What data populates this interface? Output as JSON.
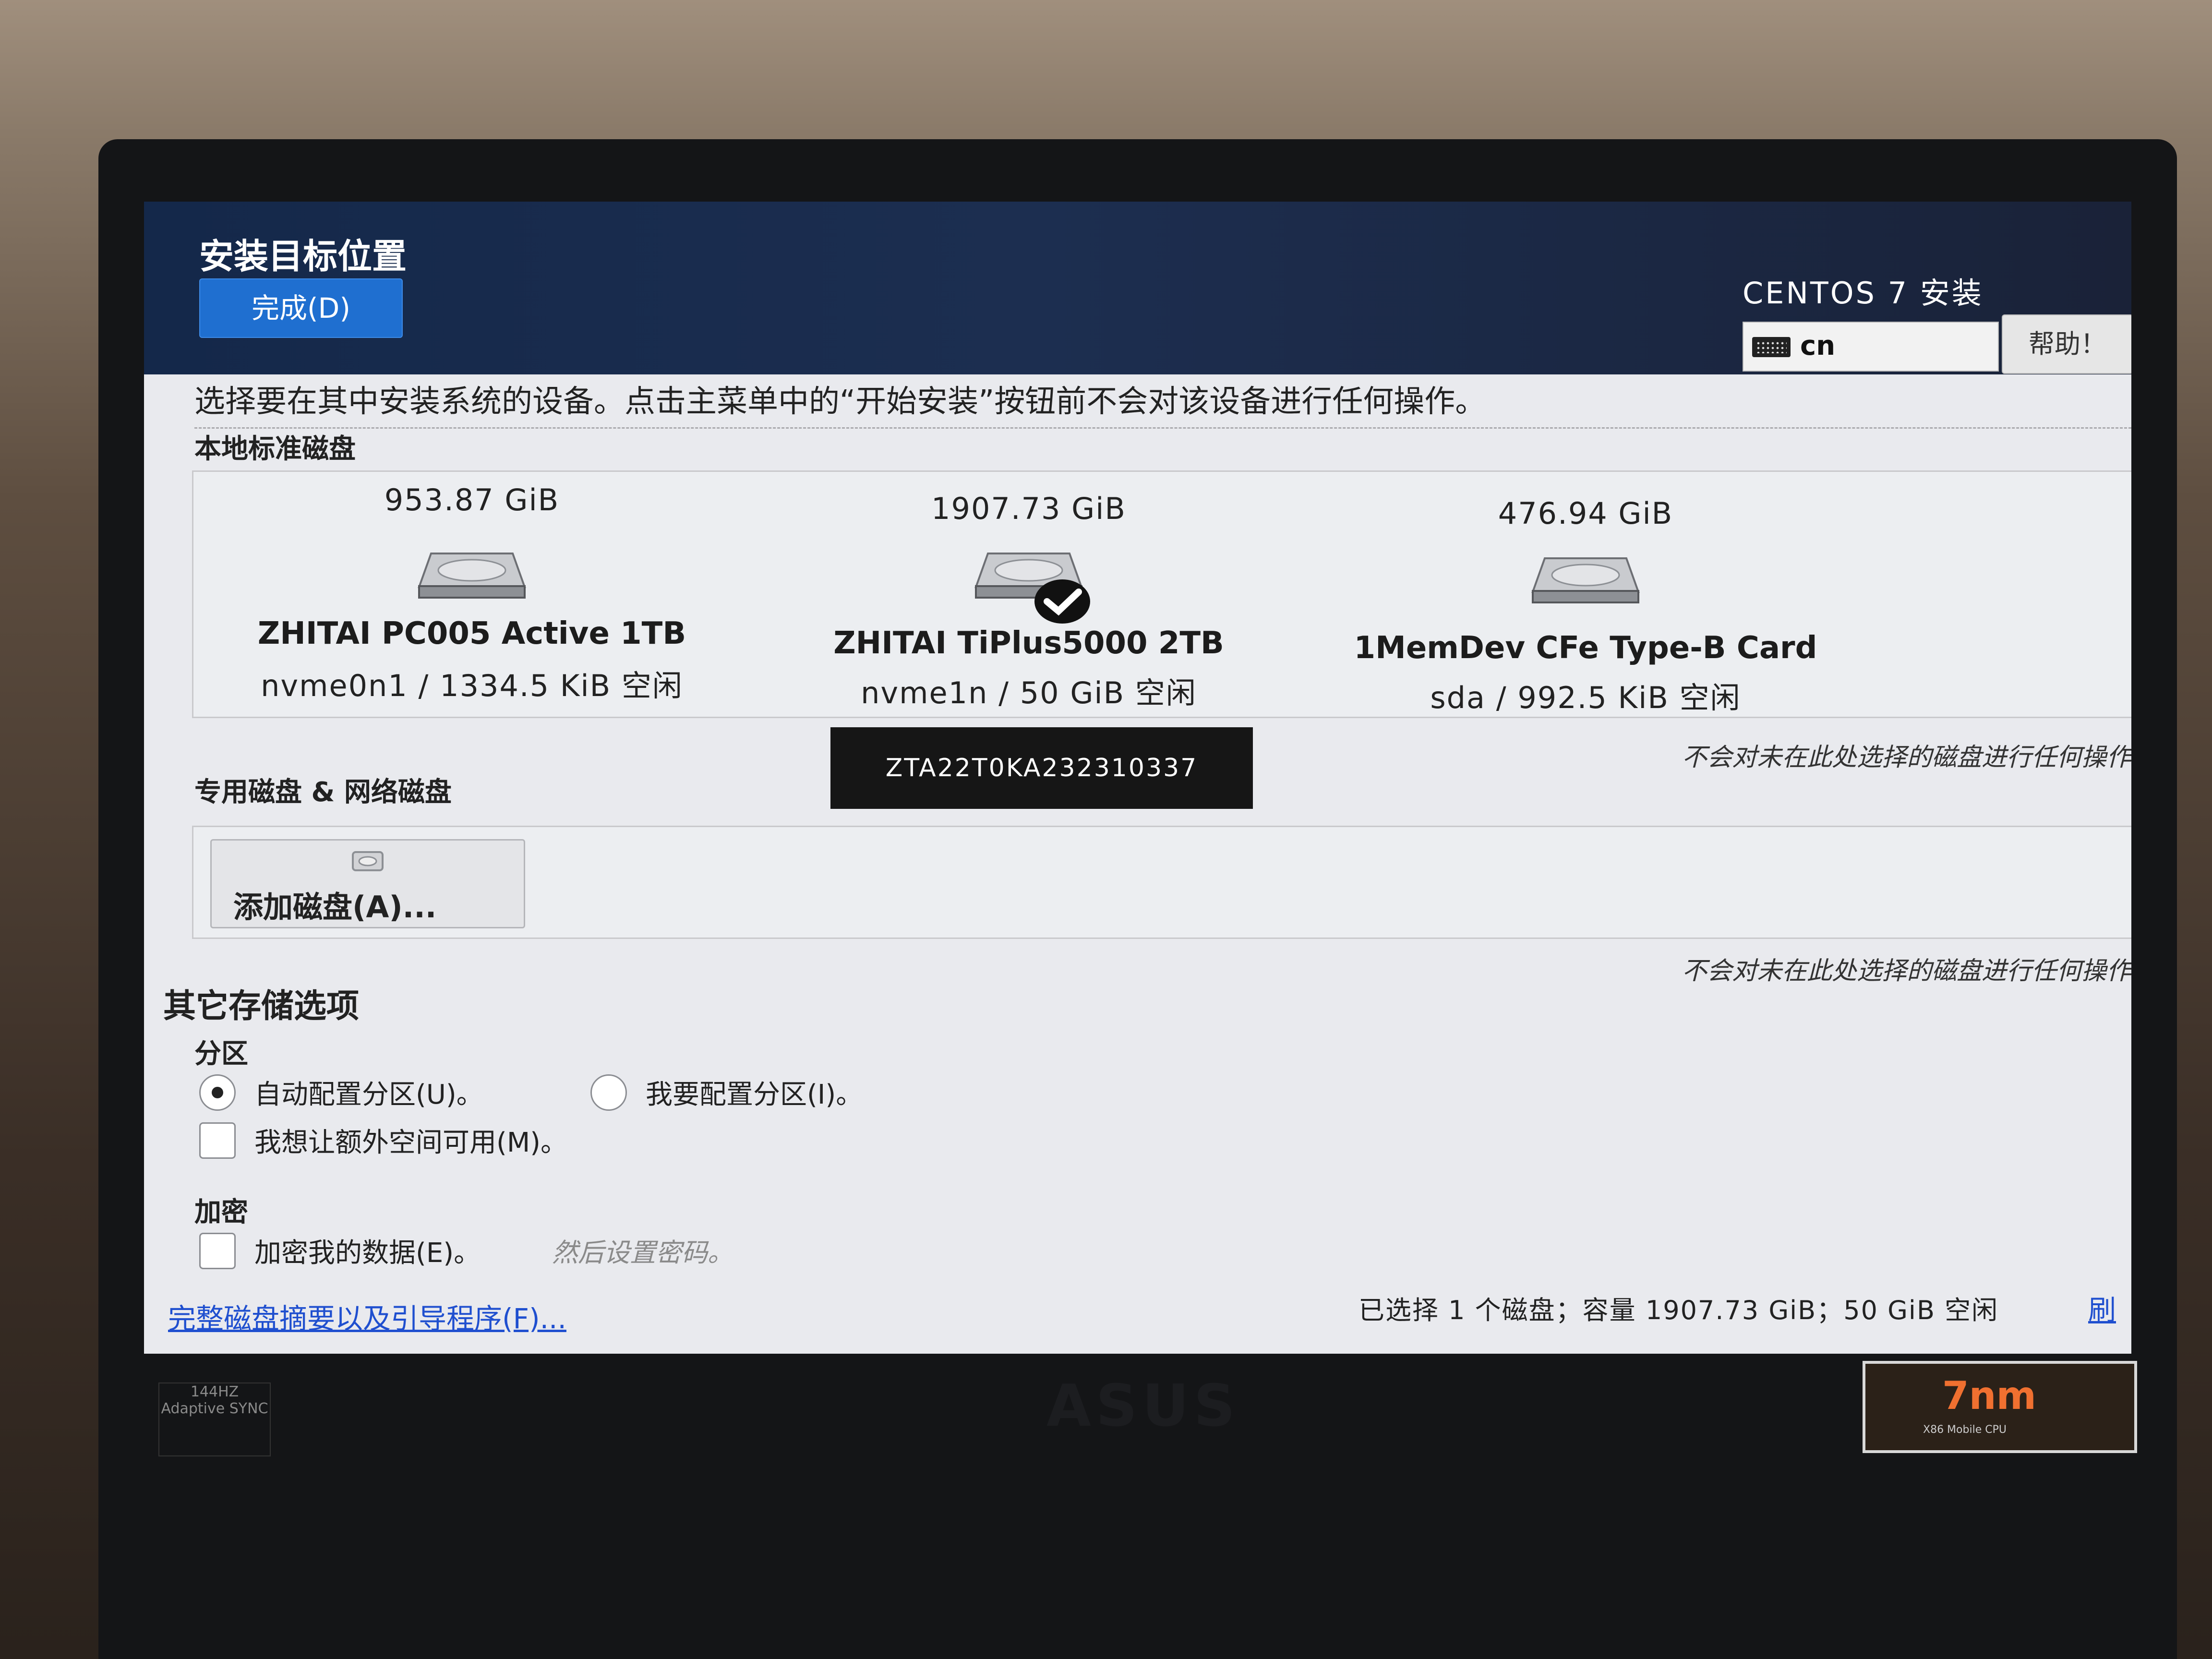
{
  "header": {
    "page_title": "安装目标位置",
    "done_label": "完成(D)",
    "product_title": "CENTOS 7 安装",
    "keyboard_layout": "cn",
    "help_label": "帮助！"
  },
  "intro_text": "选择要在其中安装系统的设备。点击主菜单中的“开始安装”按钮前不会对该设备进行任何操作。",
  "local_disks": {
    "label": "本地标准磁盘",
    "disks": [
      {
        "size": "953.87 GiB",
        "name": "ZHITAI PC005 Active 1TB",
        "device": "nvme0n1",
        "sep": "/",
        "free": "1334.5 KiB 空闲",
        "selected": false
      },
      {
        "size": "1907.73 GiB",
        "name": "ZHITAI TiPlus5000 2TB",
        "device": "nvme1n",
        "sep": "/",
        "free": "50 GiB 空闲",
        "selected": true
      },
      {
        "size": "476.94 GiB",
        "name": "1MemDev CFe Type-B Card",
        "device": "sda",
        "sep": "/",
        "free": "992.5 KiB 空闲",
        "selected": false
      }
    ],
    "note": "不会对未在此处选择的磁盘进行任何操作"
  },
  "tooltip_serial": "ZTA22T0KA232310337",
  "special_disks": {
    "label": "专用磁盘 & 网络磁盘",
    "add_disk_label": "添加磁盘(A)...",
    "note": "不会对未在此处选择的磁盘进行任何操作"
  },
  "other_options": {
    "title": "其它存储选项",
    "partition_label": "分区",
    "auto_partition": "自动配置分区(U)。",
    "manual_partition": "我要配置分区(I)。",
    "extra_space": "我想让额外空间可用(M)。",
    "encryption_label": "加密",
    "encrypt_data": "加密我的数据(E)。",
    "encrypt_hint": "然后设置密码。"
  },
  "footer": {
    "summary_link": "完整磁盘摘要以及引导程序(F)...",
    "status": "已选择 1 个磁盘；容量 1907.73 GiB；50 GiB 空闲",
    "refresh_link": "刷"
  },
  "hardware": {
    "sync_badge": "144HZ Adaptive SYNC",
    "cpu_badge_big": "7nm",
    "cpu_badge_small": "X86 Mobile CPU",
    "brand": "ASUS"
  },
  "colors": {
    "header_bg": "#1c2e50",
    "done_button": "#1f6fd0",
    "link": "#1f4fcf",
    "tooltip_bg": "#161616"
  }
}
